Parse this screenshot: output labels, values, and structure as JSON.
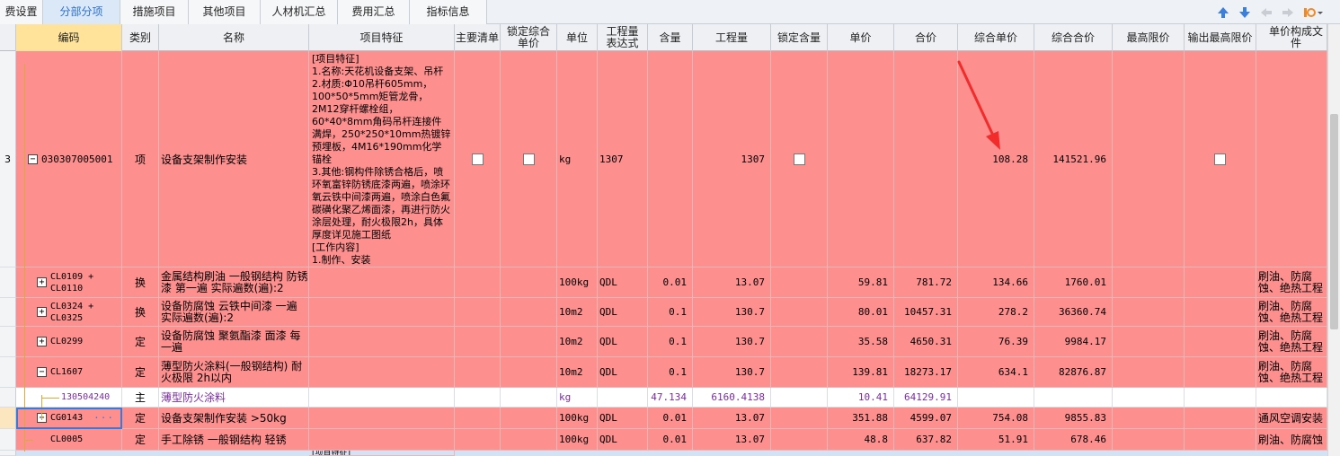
{
  "tabs": [
    {
      "label": "费设置"
    },
    {
      "label": "分部分项"
    },
    {
      "label": "措施项目"
    },
    {
      "label": "其他项目"
    },
    {
      "label": "人材机汇总"
    },
    {
      "label": "费用汇总"
    },
    {
      "label": "指标信息"
    }
  ],
  "active_tab": "分部分项",
  "toolbar_icons": [
    "arrow-up-icon",
    "arrow-down-icon",
    "arrow-left-icon",
    "arrow-right-icon",
    "settings-icon"
  ],
  "columns": [
    {
      "label": "编码"
    },
    {
      "label": "类别"
    },
    {
      "label": "名称"
    },
    {
      "label": "项目特征"
    },
    {
      "label": "主要清单"
    },
    {
      "label": "锁定综合单价"
    },
    {
      "label": "单位"
    },
    {
      "label": "工程量表达式"
    },
    {
      "label": "含量"
    },
    {
      "label": "工程量"
    },
    {
      "label": "锁定含量"
    },
    {
      "label": "单价"
    },
    {
      "label": "合价"
    },
    {
      "label": "综合单价"
    },
    {
      "label": "综合合价"
    },
    {
      "label": "最高限价"
    },
    {
      "label": "输出最高限价"
    },
    {
      "label": "单价构成文件"
    }
  ],
  "main_row": {
    "row_no": "3",
    "expander": "−",
    "code": "030307005001",
    "category": "项",
    "name": "设备支架制作安装",
    "feature": "[项目特征]\n1.名称:天花机设备支架、吊杆\n2.材质:Φ10吊杆605mm，100*50*5mm矩管龙骨，2M12穿杆螺栓组，60*40*8mm角码吊杆连接件满焊，250*250*10mm热镀锌预埋板，4M16*190mm化学锚栓\n3.其他:钢构件除锈合格后，喷环氧富锌防锈底漆两遍，喷涂环氧云铁中间漆两遍，喷涂白色氟碳磺化聚乙烯面漆，再进行防火涂层处理，耐火极限2h，具体厚度详见施工图纸\n[工作内容]\n1.制作、安装",
    "unit": "kg",
    "expr": "1307",
    "qty": "1307",
    "comp_price": "108.28",
    "comp_total": "141521.96"
  },
  "sub_rows": [
    {
      "code": "CL0109 +\nCL0110",
      "expander": "+",
      "category": "换",
      "name": "金属结构刷油 一般钢结构 防锈漆 第一遍  实际遍数(遍):2",
      "unit": "100kg",
      "expr": "QDL",
      "content": "0.01",
      "qty": "13.07",
      "price": "59.81",
      "total": "781.72",
      "comp_price": "134.66",
      "comp_total": "1760.01",
      "file": "刷油、防腐蚀、绝热工程"
    },
    {
      "code": "CL0324 +\nCL0325",
      "expander": "+",
      "category": "换",
      "name": "设备防腐蚀 云铁中间漆 一遍  实际遍数(遍):2",
      "unit": "10m2",
      "expr": "QDL",
      "content": "0.1",
      "qty": "130.7",
      "price": "80.01",
      "total": "10457.31",
      "comp_price": "278.2",
      "comp_total": "36360.74",
      "file": "刷油、防腐蚀、绝热工程"
    },
    {
      "code": "CL0299",
      "expander": "+",
      "category": "定",
      "name": "设备防腐蚀 聚氨酯漆 面漆 每一遍",
      "unit": "10m2",
      "expr": "QDL",
      "content": "0.1",
      "qty": "130.7",
      "price": "35.58",
      "total": "4650.31",
      "comp_price": "76.39",
      "comp_total": "9984.17",
      "file": "刷油、防腐蚀、绝热工程"
    },
    {
      "code": "CL1607",
      "expander": "−",
      "category": "定",
      "name": "薄型防火涂料(一般钢结构) 耐火极限 2h以内",
      "unit": "10m2",
      "expr": "QDL",
      "content": "0.1",
      "qty": "130.7",
      "price": "139.81",
      "total": "18273.17",
      "comp_price": "634.1",
      "comp_total": "82876.87",
      "file": "刷油、防腐蚀、绝热工程"
    }
  ],
  "material_row": {
    "code": "130504240",
    "category": "主",
    "name": "薄型防火涂料",
    "unit": "kg",
    "content": "47.134",
    "qty": "6160.4138",
    "price": "10.41",
    "total": "64129.91"
  },
  "tail_rows": [
    {
      "code": "CG0143",
      "expander": "+",
      "category": "定",
      "name": "设备支架制作安装 >50kg",
      "unit": "100kg",
      "expr": "QDL",
      "content": "0.01",
      "qty": "13.07",
      "price": "351.88",
      "total": "4599.07",
      "comp_price": "754.08",
      "comp_total": "9855.83",
      "file": "通风空调安装"
    },
    {
      "code": "CL0005",
      "expander": "",
      "category": "定",
      "name": "手工除锈 一般钢结构 轻锈",
      "unit": "100kg",
      "expr": "QDL",
      "content": "0.01",
      "qty": "13.07",
      "price": "48.8",
      "total": "637.82",
      "comp_price": "51.91",
      "comp_total": "678.46",
      "file": "刷油、防腐蚀"
    }
  ],
  "next_row_feature_label": "[项目特征]",
  "selected_cell_ellipsis": "···",
  "colors": {
    "row_pink": "#fe8f8f",
    "active_tab": "#2a6fd0",
    "annotation_arrow": "#f22b2b",
    "material_text": "#7a2ca0"
  }
}
